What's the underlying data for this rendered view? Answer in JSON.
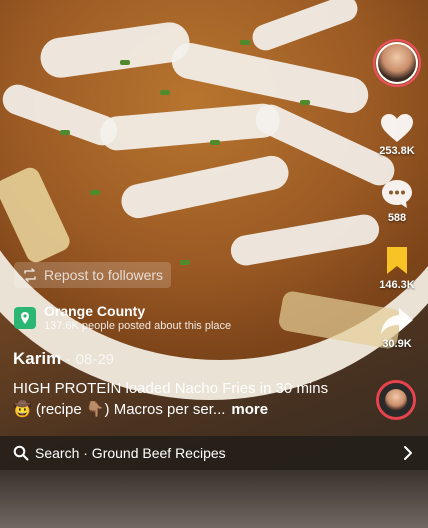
{
  "repost": {
    "label": "Repost to followers",
    "icon": "repost-icon"
  },
  "location": {
    "name": "Orange County",
    "subtitle": "137.6K people posted about this place",
    "icon": "map-pin-icon",
    "color": "#2bb673"
  },
  "post": {
    "author": "Karim",
    "separator": "·",
    "date": "08-29",
    "caption": "HIGH PROTEIN loaded Nacho Fries in 30 mins 🤠 (recipe 👇🏽)  Macros per ser...",
    "more_label": "more"
  },
  "actions": {
    "like_count": "253.8K",
    "comment_count": "588",
    "save_count": "146.3K",
    "share_count": "30.9K",
    "save_color": "#f7c325"
  },
  "search": {
    "label": "Search · Ground Beef Recipes"
  }
}
